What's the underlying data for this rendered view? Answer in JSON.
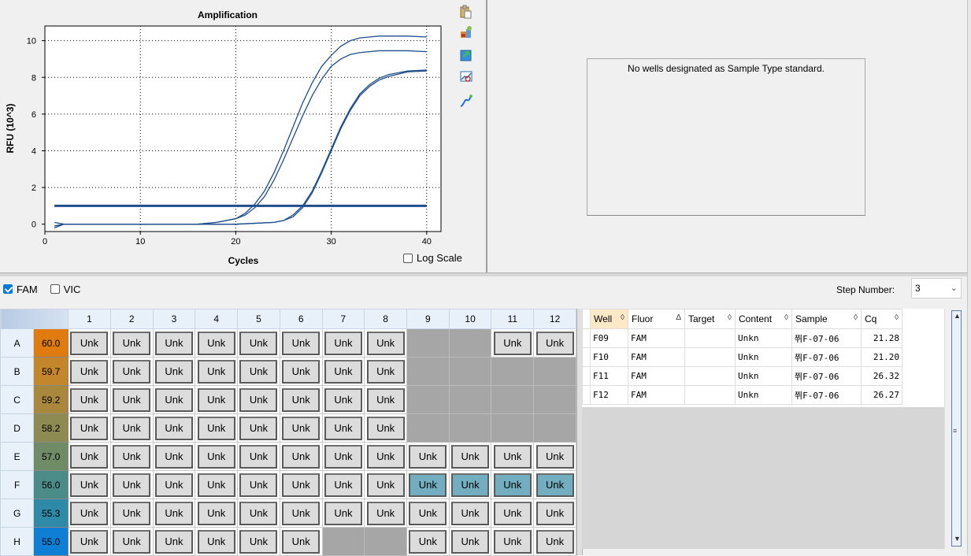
{
  "chart": {
    "title": "Amplification",
    "xlabel": "Cycles",
    "ylabel": "RFU (10^3)",
    "x_ticks": [
      "0",
      "10",
      "20",
      "30",
      "40"
    ],
    "y_ticks": [
      "0",
      "2",
      "4",
      "6",
      "8",
      "10"
    ],
    "log_scale_label": "Log Scale",
    "log_scale_checked": false
  },
  "chart_data": {
    "type": "line",
    "title": "Amplification",
    "xlabel": "Cycles",
    "ylabel": "RFU (10^3)",
    "xlim": [
      0,
      41.5
    ],
    "ylim": [
      -0.4,
      10.8
    ],
    "grid": true,
    "threshold": 1.0,
    "series": [
      {
        "x": [
          1,
          2,
          4,
          8,
          12,
          16,
          18,
          20,
          21,
          22,
          23,
          24,
          25,
          26,
          27,
          28,
          29,
          30,
          31,
          32,
          33,
          34,
          35,
          36,
          38,
          40
        ],
        "values": [
          -0.1,
          0.0,
          0.0,
          0.0,
          0.0,
          0.0,
          0.1,
          0.3,
          0.6,
          1.1,
          1.8,
          2.8,
          4.0,
          5.3,
          6.6,
          7.7,
          8.6,
          9.2,
          9.7,
          10.0,
          10.15,
          10.2,
          10.25,
          10.25,
          10.25,
          10.2
        ]
      },
      {
        "x": [
          1,
          2,
          4,
          8,
          12,
          16,
          18,
          20,
          21,
          22,
          23,
          24,
          25,
          26,
          27,
          28,
          29,
          30,
          31,
          32,
          33,
          34,
          35,
          36,
          38,
          40
        ],
        "values": [
          -0.1,
          0.0,
          0.0,
          0.0,
          0.0,
          0.0,
          0.1,
          0.3,
          0.5,
          0.9,
          1.5,
          2.4,
          3.5,
          4.7,
          5.9,
          7.0,
          7.9,
          8.6,
          9.0,
          9.25,
          9.35,
          9.4,
          9.45,
          9.45,
          9.45,
          9.4
        ]
      },
      {
        "x": [
          1,
          2,
          4,
          8,
          12,
          16,
          20,
          24,
          25,
          26,
          27,
          28,
          29,
          30,
          31,
          32,
          33,
          34,
          35,
          36,
          38,
          40
        ],
        "values": [
          0.1,
          0.0,
          0.0,
          0.0,
          0.0,
          0.0,
          0.0,
          0.1,
          0.2,
          0.5,
          1.0,
          1.8,
          2.9,
          4.1,
          5.3,
          6.3,
          7.1,
          7.6,
          7.95,
          8.15,
          8.35,
          8.4
        ]
      },
      {
        "x": [
          1,
          2,
          4,
          8,
          12,
          16,
          20,
          24,
          25,
          26,
          27,
          28,
          29,
          30,
          31,
          32,
          33,
          34,
          35,
          36,
          38,
          40
        ],
        "values": [
          -0.2,
          0.0,
          0.0,
          0.0,
          0.0,
          0.0,
          0.0,
          0.1,
          0.2,
          0.4,
          0.9,
          1.7,
          2.8,
          4.0,
          5.2,
          6.2,
          7.0,
          7.5,
          7.85,
          8.05,
          8.3,
          8.35
        ]
      }
    ]
  },
  "right_panel": {
    "message": "No wells designated as Sample Type standard."
  },
  "fluor": [
    {
      "label": "FAM",
      "checked": true
    },
    {
      "label": "VIC",
      "checked": false
    }
  ],
  "step": {
    "label": "Step Number:",
    "value": "3"
  },
  "plate": {
    "columns": [
      "1",
      "2",
      "3",
      "4",
      "5",
      "6",
      "7",
      "8",
      "9",
      "10",
      "11",
      "12"
    ],
    "rows": [
      {
        "label": "A",
        "temp": "60.0",
        "color": "#e07b10",
        "wells": [
          "Unk",
          "Unk",
          "Unk",
          "Unk",
          "Unk",
          "Unk",
          "Unk",
          "Unk",
          "",
          "",
          "Unk",
          "Unk"
        ]
      },
      {
        "label": "B",
        "temp": "59.7",
        "color": "#c4862a",
        "wells": [
          "Unk",
          "Unk",
          "Unk",
          "Unk",
          "Unk",
          "Unk",
          "Unk",
          "Unk",
          "",
          "",
          "",
          ""
        ]
      },
      {
        "label": "C",
        "temp": "59.2",
        "color": "#a9883e",
        "wells": [
          "Unk",
          "Unk",
          "Unk",
          "Unk",
          "Unk",
          "Unk",
          "Unk",
          "Unk",
          "",
          "",
          "",
          ""
        ]
      },
      {
        "label": "D",
        "temp": "58.2",
        "color": "#8d8a52",
        "wells": [
          "Unk",
          "Unk",
          "Unk",
          "Unk",
          "Unk",
          "Unk",
          "Unk",
          "Unk",
          "",
          "",
          "",
          ""
        ]
      },
      {
        "label": "E",
        "temp": "57.0",
        "color": "#6f8c66",
        "wells": [
          "Unk",
          "Unk",
          "Unk",
          "Unk",
          "Unk",
          "Unk",
          "Unk",
          "Unk",
          "Unk",
          "Unk",
          "Unk",
          "Unk"
        ]
      },
      {
        "label": "F",
        "temp": "56.0",
        "color": "#4c8c88",
        "wells": [
          "Unk",
          "Unk",
          "Unk",
          "Unk",
          "Unk",
          "Unk",
          "Unk",
          "Unk",
          "Unk",
          "Unk",
          "Unk",
          "Unk"
        ]
      },
      {
        "label": "G",
        "temp": "55.3",
        "color": "#2e8aa6",
        "wells": [
          "Unk",
          "Unk",
          "Unk",
          "Unk",
          "Unk",
          "Unk",
          "Unk",
          "Unk",
          "Unk",
          "Unk",
          "Unk",
          "Unk"
        ]
      },
      {
        "label": "H",
        "temp": "55.0",
        "color": "#0f7fd6",
        "wells": [
          "Unk",
          "Unk",
          "Unk",
          "Unk",
          "Unk",
          "Unk",
          "",
          "",
          "Unk",
          "Unk",
          "Unk",
          "Unk"
        ]
      }
    ],
    "selected": [
      "F9",
      "F10",
      "F11",
      "F12"
    ]
  },
  "data_grid": {
    "columns": [
      "Well",
      "Fluor",
      "Target",
      "Content",
      "Sample",
      "Cq"
    ],
    "sort_glyphs": [
      "◊",
      "Δ",
      "◊",
      "◊",
      "◊",
      "◊"
    ],
    "rows": [
      {
        "well": "F09",
        "fluor": "FAM",
        "target": "",
        "content": "Unkn",
        "sample": "쮜F-07-06",
        "cq": "21.28"
      },
      {
        "well": "F10",
        "fluor": "FAM",
        "target": "",
        "content": "Unkn",
        "sample": "쮜F-07-06",
        "cq": "21.20"
      },
      {
        "well": "F11",
        "fluor": "FAM",
        "target": "",
        "content": "Unkn",
        "sample": "쮜F-07-06",
        "cq": "26.32"
      },
      {
        "well": "F12",
        "fluor": "FAM",
        "target": "",
        "content": "Unkn",
        "sample": "쮜F-07-06",
        "cq": "26.27"
      }
    ]
  },
  "icons": [
    "clipboard-icon",
    "plate-setup-icon",
    "export-icon",
    "zoom-chart-icon",
    "curve-icon"
  ],
  "colors": {
    "curve": "#1f4e8c",
    "threshold": "#1f4e8c",
    "selected_well": "#72aec0",
    "empty_well": "#a6a6a6"
  }
}
